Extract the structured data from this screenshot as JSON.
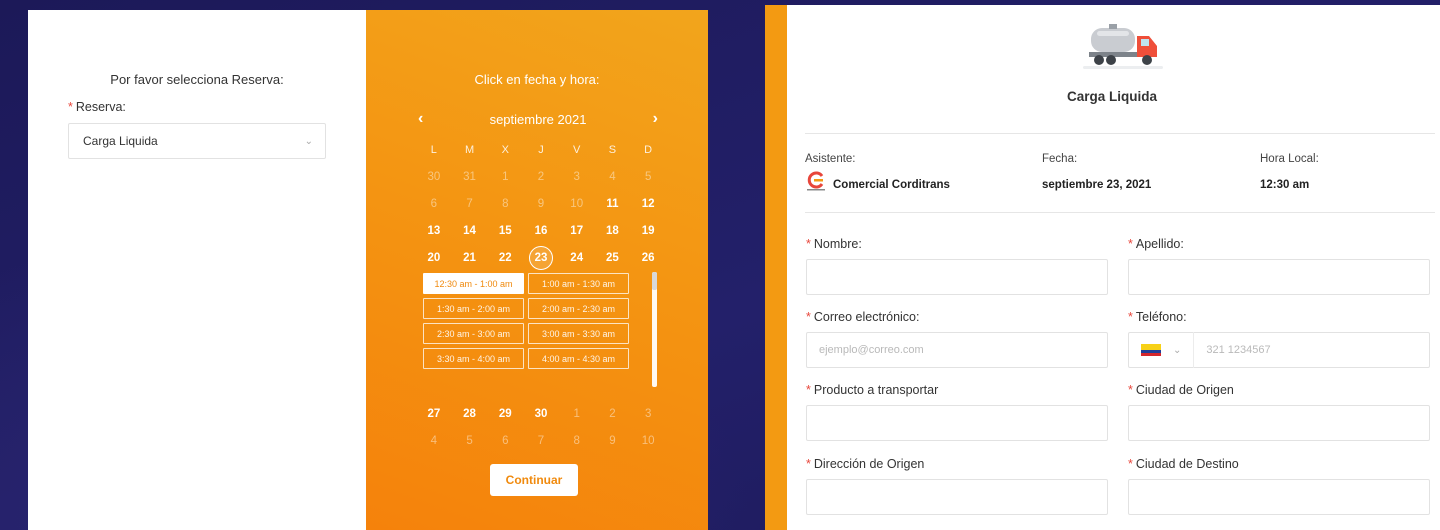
{
  "left_card": {
    "title": "Por favor selecciona Reserva:",
    "reserva_label": "Reserva:",
    "reserva_value": "Carga Liquida"
  },
  "calendar": {
    "title": "Click en fecha y hora:",
    "month": "septiembre 2021",
    "weekdays": [
      "L",
      "M",
      "X",
      "J",
      "V",
      "S",
      "D"
    ],
    "weeks_top": [
      [
        "30",
        "31",
        "1",
        "2",
        "3",
        "4",
        "5"
      ],
      [
        "6",
        "7",
        "8",
        "9",
        "10",
        "11",
        "12"
      ],
      [
        "13",
        "14",
        "15",
        "16",
        "17",
        "18",
        "19"
      ],
      [
        "20",
        "21",
        "22",
        "23",
        "24",
        "25",
        "26"
      ]
    ],
    "weeks_bottom": [
      [
        "27",
        "28",
        "29",
        "30",
        "1",
        "2",
        "3"
      ],
      [
        "4",
        "5",
        "6",
        "7",
        "8",
        "9",
        "10"
      ]
    ],
    "selected_day": "23",
    "time_slots": [
      "12:30 am - 1:00 am",
      "1:00 am - 1:30 am",
      "1:30 am - 2:00 am",
      "2:00 am - 2:30 am",
      "2:30 am - 3:00 am",
      "3:00 am - 3:30 am",
      "3:30 am - 4:00 am",
      "4:00 am - 4:30 am"
    ],
    "selected_slot": "12:30 am - 1:00 am",
    "continue_label": "Continuar"
  },
  "right_card": {
    "title": "Carga Liquida",
    "asistente_label": "Asistente:",
    "asistente_value": "Comercial Corditrans",
    "fecha_label": "Fecha:",
    "fecha_value": "septiembre 23, 2021",
    "hora_label": "Hora Local:",
    "hora_value": "12:30 am",
    "fields": {
      "nombre": "Nombre:",
      "apellido": "Apellido:",
      "correo": "Correo electrónico:",
      "correo_placeholder": "ejemplo@correo.com",
      "telefono": "Teléfono:",
      "telefono_placeholder": "321 1234567",
      "producto": "Producto a transportar",
      "ciudad_origen": "Ciudad de Origen",
      "direccion_origen": "Dirección de Origen",
      "ciudad_destino": "Ciudad de Destino"
    }
  },
  "colors": {
    "accent_orange": "#f49512",
    "required_red": "#e8463b",
    "background_navy": "#1f1c5a"
  }
}
